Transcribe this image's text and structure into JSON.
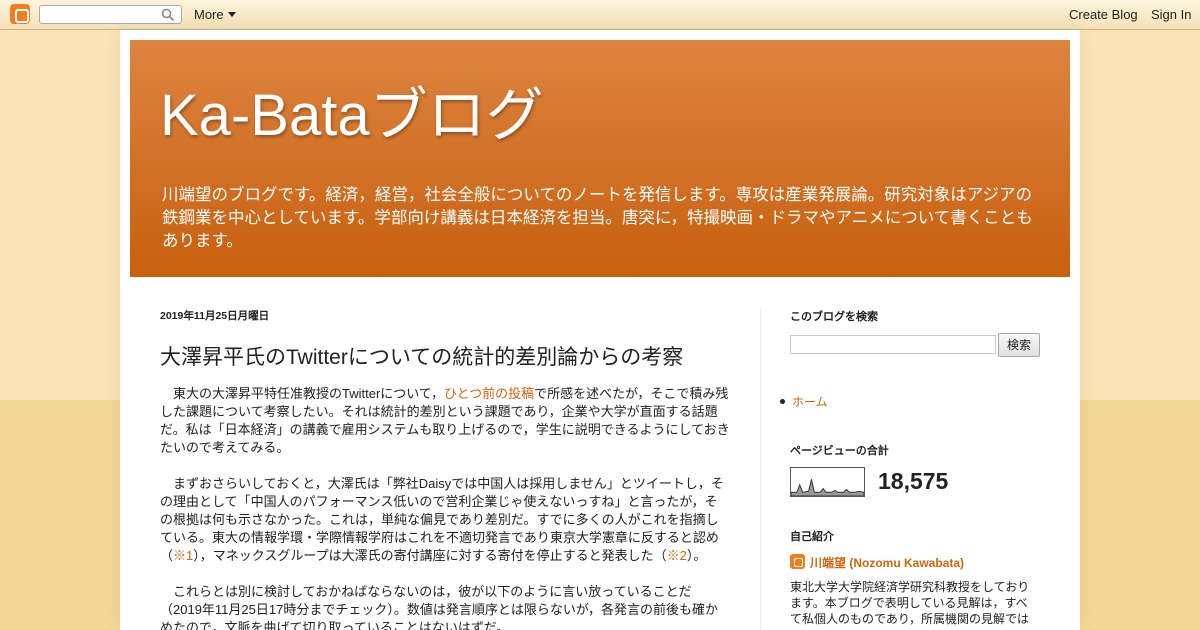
{
  "navbar": {
    "more_label": "More",
    "create_blog_label": "Create Blog",
    "sign_in_label": "Sign In"
  },
  "header": {
    "title": "Ka-Bataブログ",
    "description": "川端望のブログです。経済，経営，社会全般についてのノートを発信します。専攻は産業発展論。研究対象はアジアの鉄鋼業を中心としています。学部向け講義は日本経済を担当。唐突に，特撮映画・ドラマやアニメについて書くこともあります。"
  },
  "post": {
    "date": "2019年11月25日月曜日",
    "title": "大澤昇平氏のTwitterについての統計的差別論からの考察",
    "p1_a": "東大の大澤昇平特任准教授のTwitterについて，",
    "p1_link": "ひとつ前の投稿",
    "p1_b": "で所感を述べたが，そこで積み残した課題について考察したい。それは統計的差別という課題であり，企業や大学が直面する話題だ。私は「日本経済」の講義で雇用システムも取り上げるので，学生に説明できるようにしておきたいので考えてみる。",
    "p2_a": "まずおさらいしておくと，大澤氏は「弊社Daisyでは中国人は採用しません」とツイートし，その理由として「中国人のパフォーマンス低いので営利企業じゃ使えないっすね」と言ったが，その根拠は何も示さなかった。これは，単純な偏見であり差別だ。すでに多くの人がこれを指摘している。東大の情報学環・学際情報学府はこれを不適切発言であり東京大学憲章に反すると認め（",
    "p2_note1": "※1",
    "p2_b": "），マネックスグループは大澤氏の寄付講座に対する寄付を停止すると発表した（",
    "p2_note2": "※2",
    "p2_c": "）。",
    "p3": "これらとは別に検討しておかねばならないのは，彼が以下のように言い放っていることだ（2019年11月25日17時分までチェック）。数値は発言順序とは限らないが，各発言の前後も確かめたので，文脈を曲げて切り取っていることはないはずだ。"
  },
  "sidebar": {
    "search_heading": "このブログを検索",
    "search_button": "検索",
    "home_link": "ホーム",
    "pageviews_heading": "ページビューの合計",
    "pageviews_count": "18,575",
    "profile_heading": "自己紹介",
    "profile_name": "川端望 (Nozomu Kawabata)",
    "profile_desc": "東北大学大学院経済学研究科教授をしております。本ブログで表明している見解は，すべて私個人のものであり，所属機関の見解では"
  },
  "colors": {
    "header_top": "#dc8440",
    "header_bottom": "#c8600f",
    "link": "#cc6611",
    "background": "#fbe5b6"
  },
  "icons": [
    "blogger-icon",
    "search-icon",
    "chevron-down-icon",
    "profile-icon"
  ]
}
